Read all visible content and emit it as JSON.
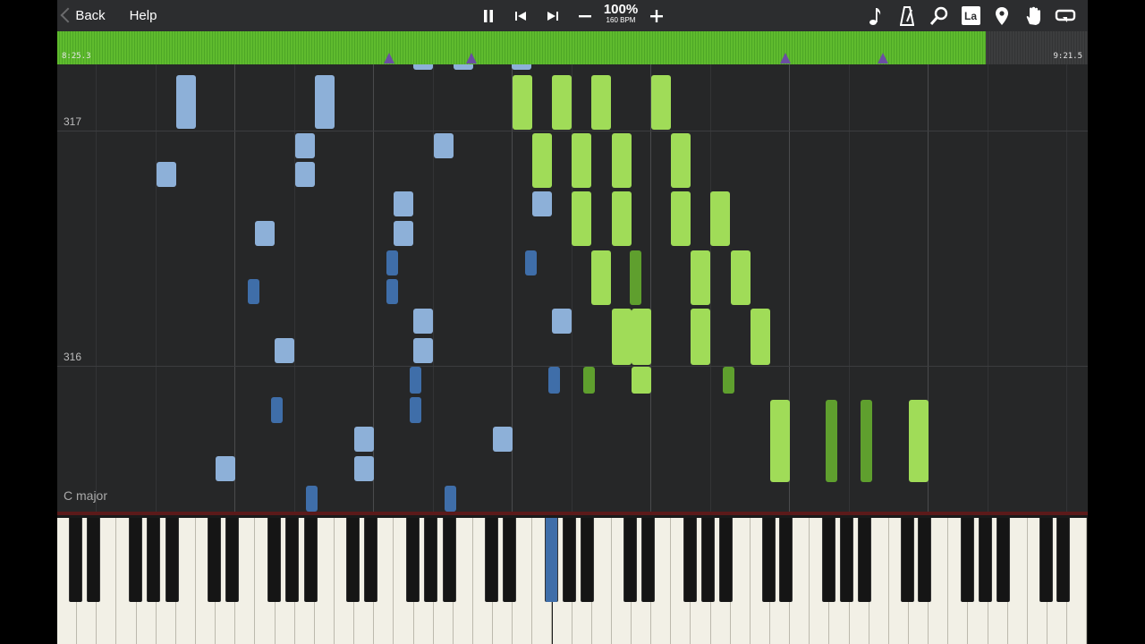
{
  "toolbar": {
    "back_label": "Back",
    "help_label": "Help",
    "tempo_percent": "100%",
    "tempo_bpm": "160 BPM",
    "icons": [
      "pause-icon",
      "skip-back-icon",
      "skip-forward-icon",
      "minus-icon",
      "plus-icon",
      "note-icon",
      "metronome-icon",
      "magnifier-icon",
      "note-name-icon",
      "location-pin-icon",
      "hand-icon",
      "loop-icon"
    ],
    "note_label_text": "La"
  },
  "progress": {
    "elapsed": "8:25.3",
    "total": "9:21.5",
    "fraction": 0.9
  },
  "notes_area": {
    "measure_labels": [
      "317",
      "316"
    ],
    "key_signature": "C major"
  },
  "colors": {
    "left_hand_light": "#8db0d8",
    "left_hand_dark": "#3f6ea9",
    "right_hand_light": "#a0dc58",
    "right_hand_dark": "#5f9f2e",
    "progress": "#5fbb2e",
    "marker": "#6b4ea3"
  }
}
